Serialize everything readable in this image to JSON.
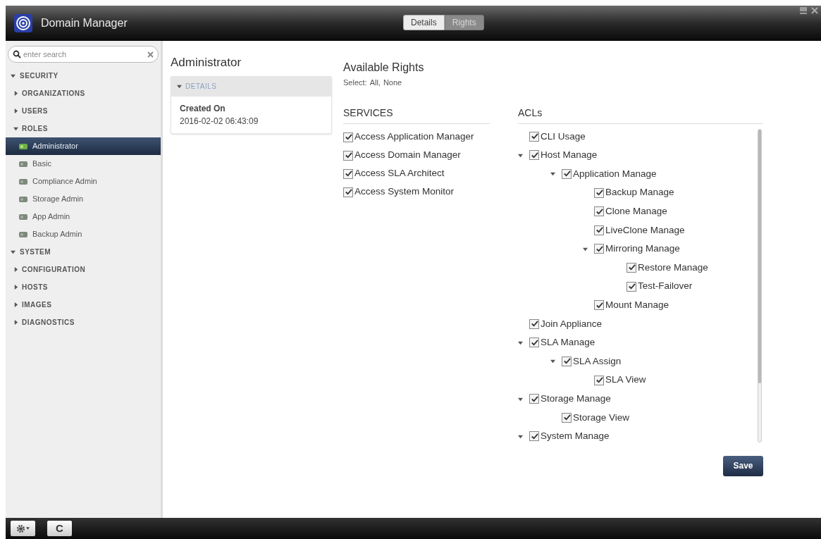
{
  "window": {
    "title": "Domain Manager"
  },
  "tabs": [
    {
      "label": "Details",
      "selected": false
    },
    {
      "label": "Rights",
      "selected": true
    }
  ],
  "search": {
    "placeholder": "enter search"
  },
  "nav": [
    {
      "label": "SECURITY",
      "expanded": true,
      "children": [
        {
          "label": "ORGANIZATIONS",
          "expanded": false
        },
        {
          "label": "USERS",
          "expanded": false
        },
        {
          "label": "ROLES",
          "expanded": true,
          "roles": [
            {
              "label": "Administrator",
              "selected": true
            },
            {
              "label": "Basic",
              "selected": false
            },
            {
              "label": "Compliance Admin",
              "selected": false
            },
            {
              "label": "Storage Admin",
              "selected": false
            },
            {
              "label": "App Admin",
              "selected": false
            },
            {
              "label": "Backup Admin",
              "selected": false
            }
          ]
        }
      ]
    },
    {
      "label": "SYSTEM",
      "expanded": true,
      "children": [
        {
          "label": "CONFIGURATION",
          "expanded": false
        },
        {
          "label": "HOSTS",
          "expanded": false
        },
        {
          "label": "IMAGES",
          "expanded": false
        },
        {
          "label": "DIAGNOSTICS",
          "expanded": false
        }
      ]
    }
  ],
  "role": {
    "title": "Administrator",
    "details_header": "DETAILS",
    "details_expanded": true,
    "created_label": "Created On",
    "created_value": "2016-02-02 06:43:09"
  },
  "rights": {
    "title": "Available Rights",
    "select_prefix": "Select:",
    "select_all": "All,",
    "select_none": "None",
    "services_header": "SERVICES",
    "services": [
      {
        "label": "Access Application Manager",
        "checked": true
      },
      {
        "label": "Access Domain Manager",
        "checked": true
      },
      {
        "label": "Access SLA Architect",
        "checked": true
      },
      {
        "label": "Access System Monitor",
        "checked": true
      }
    ],
    "acls_header": "ACLs",
    "acls": [
      {
        "label": "CLI Usage",
        "checked": true
      },
      {
        "label": "Host Manage",
        "checked": true,
        "expanded": true,
        "children": [
          {
            "label": "Application Manage",
            "checked": true,
            "expanded": true,
            "children": [
              {
                "label": "Backup Manage",
                "checked": true
              },
              {
                "label": "Clone Manage",
                "checked": true
              },
              {
                "label": "LiveClone Manage",
                "checked": true
              },
              {
                "label": "Mirroring Manage",
                "checked": true,
                "expanded": true,
                "children": [
                  {
                    "label": "Restore Manage",
                    "checked": true
                  },
                  {
                    "label": "Test-Failover",
                    "checked": true
                  }
                ]
              },
              {
                "label": "Mount Manage",
                "checked": true
              }
            ]
          }
        ]
      },
      {
        "label": "Join Appliance",
        "checked": true
      },
      {
        "label": "SLA Manage",
        "checked": true,
        "expanded": true,
        "children": [
          {
            "label": "SLA Assign",
            "checked": true,
            "expanded": true,
            "children": [
              {
                "label": "SLA View",
                "checked": true
              }
            ]
          }
        ]
      },
      {
        "label": "Storage Manage",
        "checked": true,
        "expanded": true,
        "children": [
          {
            "label": "Storage View",
            "checked": true
          }
        ]
      },
      {
        "label": "System Manage",
        "checked": true,
        "expanded": true
      }
    ],
    "save": "Save"
  },
  "footer": {
    "refresh_label": "C"
  }
}
